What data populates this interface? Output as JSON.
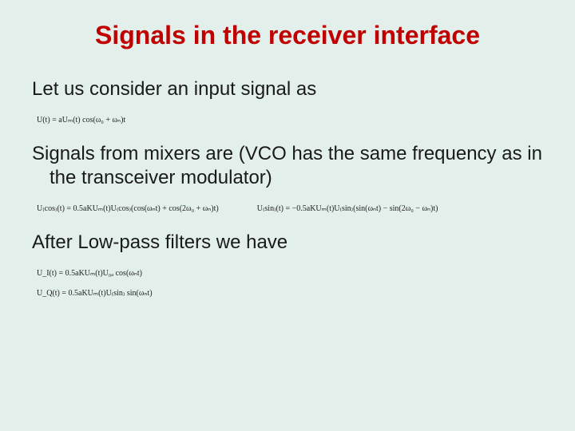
{
  "title": "Signals in the receiver interface",
  "p1": "Let us consider an input signal as",
  "eq1": "U(t) = aUₘ(t) cos(ω₀ + ωₙ)t",
  "p2": "Signals from mixers are (VCO has the same frequency as in the transceiver  modulator)",
  "eq2a": "U₍cos₎(t) = 0.5aKUₘ(t)U₍cos₎(cos(ωₙt) + cos(2ω₀ + ωₙ)t)",
  "eq2b": "U₍sin₎(t) = −0.5aKUₘ(t)U₍sin₎(sin(ωₙt) − sin(2ω₀ − ωₙ)t)",
  "p3": "After Low-pass filters we have",
  "eq3a": "U_I(t) = 0.5aKUₘ(t)U₀ₐ cos(ωₙt)",
  "eq3b": "U_Q(t) =  0.5aKUₘ(t)U₍sin₎ sin(ωₙt)"
}
